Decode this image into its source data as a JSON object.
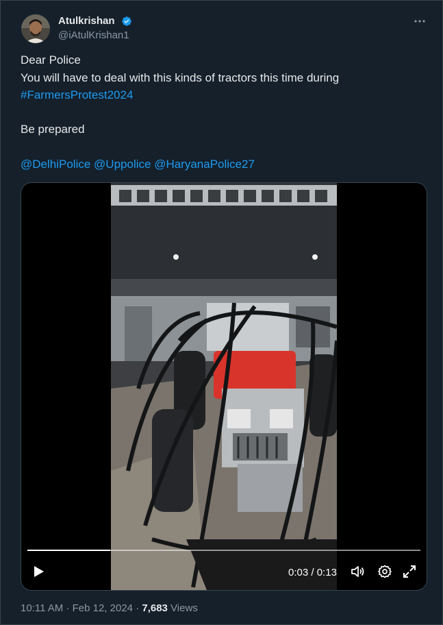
{
  "author": {
    "name": "Atulkrishan",
    "handle": "@iAtulKrishan1",
    "verified": true
  },
  "menu": {
    "more_icon": "more-horizontal-icon"
  },
  "tweet": {
    "line1": "Dear Police",
    "line2": "You will have to deal with this kinds of tractors this time during",
    "hashtag": "#FarmersProtest2024",
    "line4": "Be prepared",
    "mentions": [
      "@DelhiPolice",
      "@Uppolice",
      "@HaryanaPolice27"
    ]
  },
  "video": {
    "current_time": "0:03",
    "separator": "/",
    "duration": "0:13",
    "progress_fraction": 0.21,
    "controls": [
      "play-icon",
      "volume-icon",
      "settings-icon",
      "fullscreen-icon"
    ]
  },
  "meta": {
    "time": "10:11 AM",
    "dot": "·",
    "date": "Feb 12, 2024",
    "views_count": "7,683",
    "views_label": "Views"
  },
  "colors": {
    "background": "#15202b",
    "text": "#e7e9ea",
    "secondary": "#8b98a5",
    "link": "#1d9bf0",
    "tractor": "#d9342b"
  }
}
